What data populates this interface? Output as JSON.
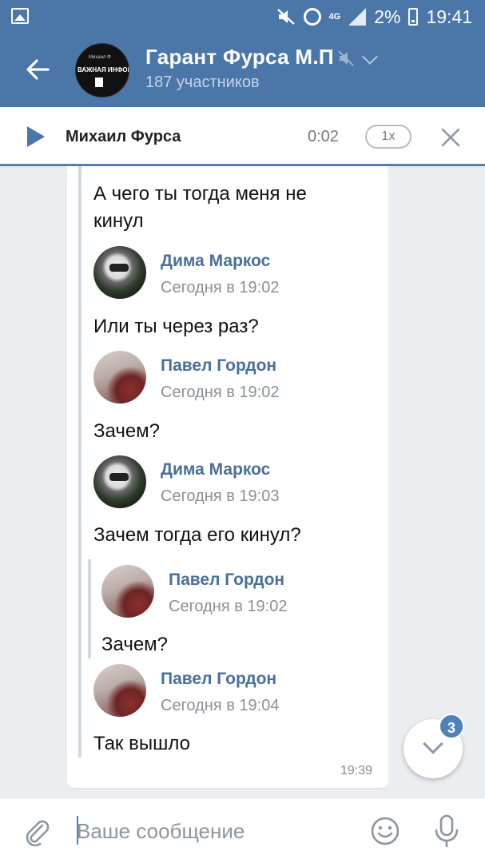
{
  "status_bar": {
    "network": "4G",
    "battery": "2%",
    "time": "19:41"
  },
  "header": {
    "title": "Гарант Фурса М.П",
    "subtitle": "187 участников",
    "avatar_text_top": "Михаил Ф",
    "avatar_text_main": "ВАЖНАЯ ИНФОРМАЦИЯ"
  },
  "player": {
    "name": "Михаил Фурса",
    "time": "0:02",
    "speed": "1x"
  },
  "message": {
    "first_text": "А чего ты тогда меня не кинул",
    "posts": [
      {
        "name": "Дима Маркос",
        "date": "Сегодня в 19:02",
        "text": "Или ты через раз?"
      },
      {
        "name": "Павел Гордон",
        "date": "Сегодня в 19:02",
        "text": "Зачем?"
      },
      {
        "name": "Дима Маркос",
        "date": "Сегодня в 19:03",
        "text": "Зачем тогда его кинул?"
      }
    ],
    "nested": {
      "name": "Павел Гордон",
      "date": "Сегодня в 19:02",
      "text": "Зачем?"
    },
    "last": {
      "name": "Павел Гордон",
      "date": "Сегодня в 19:04",
      "text": "Так вышло"
    },
    "time": "19:39"
  },
  "unread_badge": "3",
  "composer": {
    "placeholder": "Ваше сообщение"
  },
  "colors": {
    "accent": "#4a76a8",
    "link": "#4a6f9a",
    "badge": "#5181b8"
  }
}
